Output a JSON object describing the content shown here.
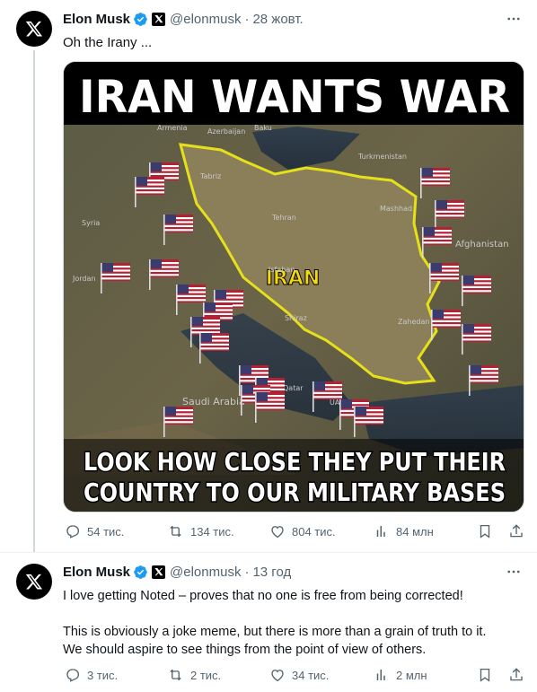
{
  "tweets": [
    {
      "author": {
        "name": "Elon Musk",
        "handle": "@elonmusk"
      },
      "time": "28 жовт.",
      "text": "Oh the Irany ...",
      "image": {
        "headline": "IRAN WANTS WAR",
        "center_label": "IRAN",
        "caption_line1": "LOOK HOW CLOSE THEY PUT THEIR",
        "caption_line2": "COUNTRY TO OUR MILITARY BASES",
        "map_labels": {
          "armenia": "Armenia",
          "azerbaijan": "Azerbaijan",
          "baku": "Baku",
          "turkmenistan": "Turkmenistan",
          "tabriz": "Tabriz",
          "mashhad": "Mashhad",
          "tehran": "Tehran",
          "afghanistan": "Afghanistan",
          "isfahan": "Isfahan",
          "shiraz": "Shiraz",
          "zahedan": "Zahedan",
          "arabia": "Saudi Arabia",
          "syria": "Syria",
          "jordan": "Jordan",
          "qatar": "Qatar",
          "uae": "UAE"
        }
      },
      "stats": {
        "replies": "54 тис.",
        "reposts": "134 тис.",
        "likes": "804 тис.",
        "views": "84 млн"
      }
    },
    {
      "author": {
        "name": "Elon Musk",
        "handle": "@elonmusk"
      },
      "time": "13 год",
      "text_line1": "I love getting Noted – proves that no one is free from being corrected!",
      "text_line2": "This is obviously a joke meme, but there is more than a grain of truth to it.",
      "text_line3": "We should aspire to see things from the point of view of others.",
      "stats": {
        "replies": "3 тис.",
        "reposts": "2 тис.",
        "likes": "34 тис.",
        "views": "2 млн"
      }
    }
  ],
  "colors": {
    "verified": "#1d9bf0",
    "secondary_text": "#536471",
    "outline": "#e6e01a"
  },
  "icons": [
    "x-logo-icon",
    "verified-badge-icon",
    "x-affiliate-icon",
    "more-icon",
    "reply-icon",
    "repost-icon",
    "like-icon",
    "views-icon",
    "bookmark-icon",
    "share-icon"
  ]
}
